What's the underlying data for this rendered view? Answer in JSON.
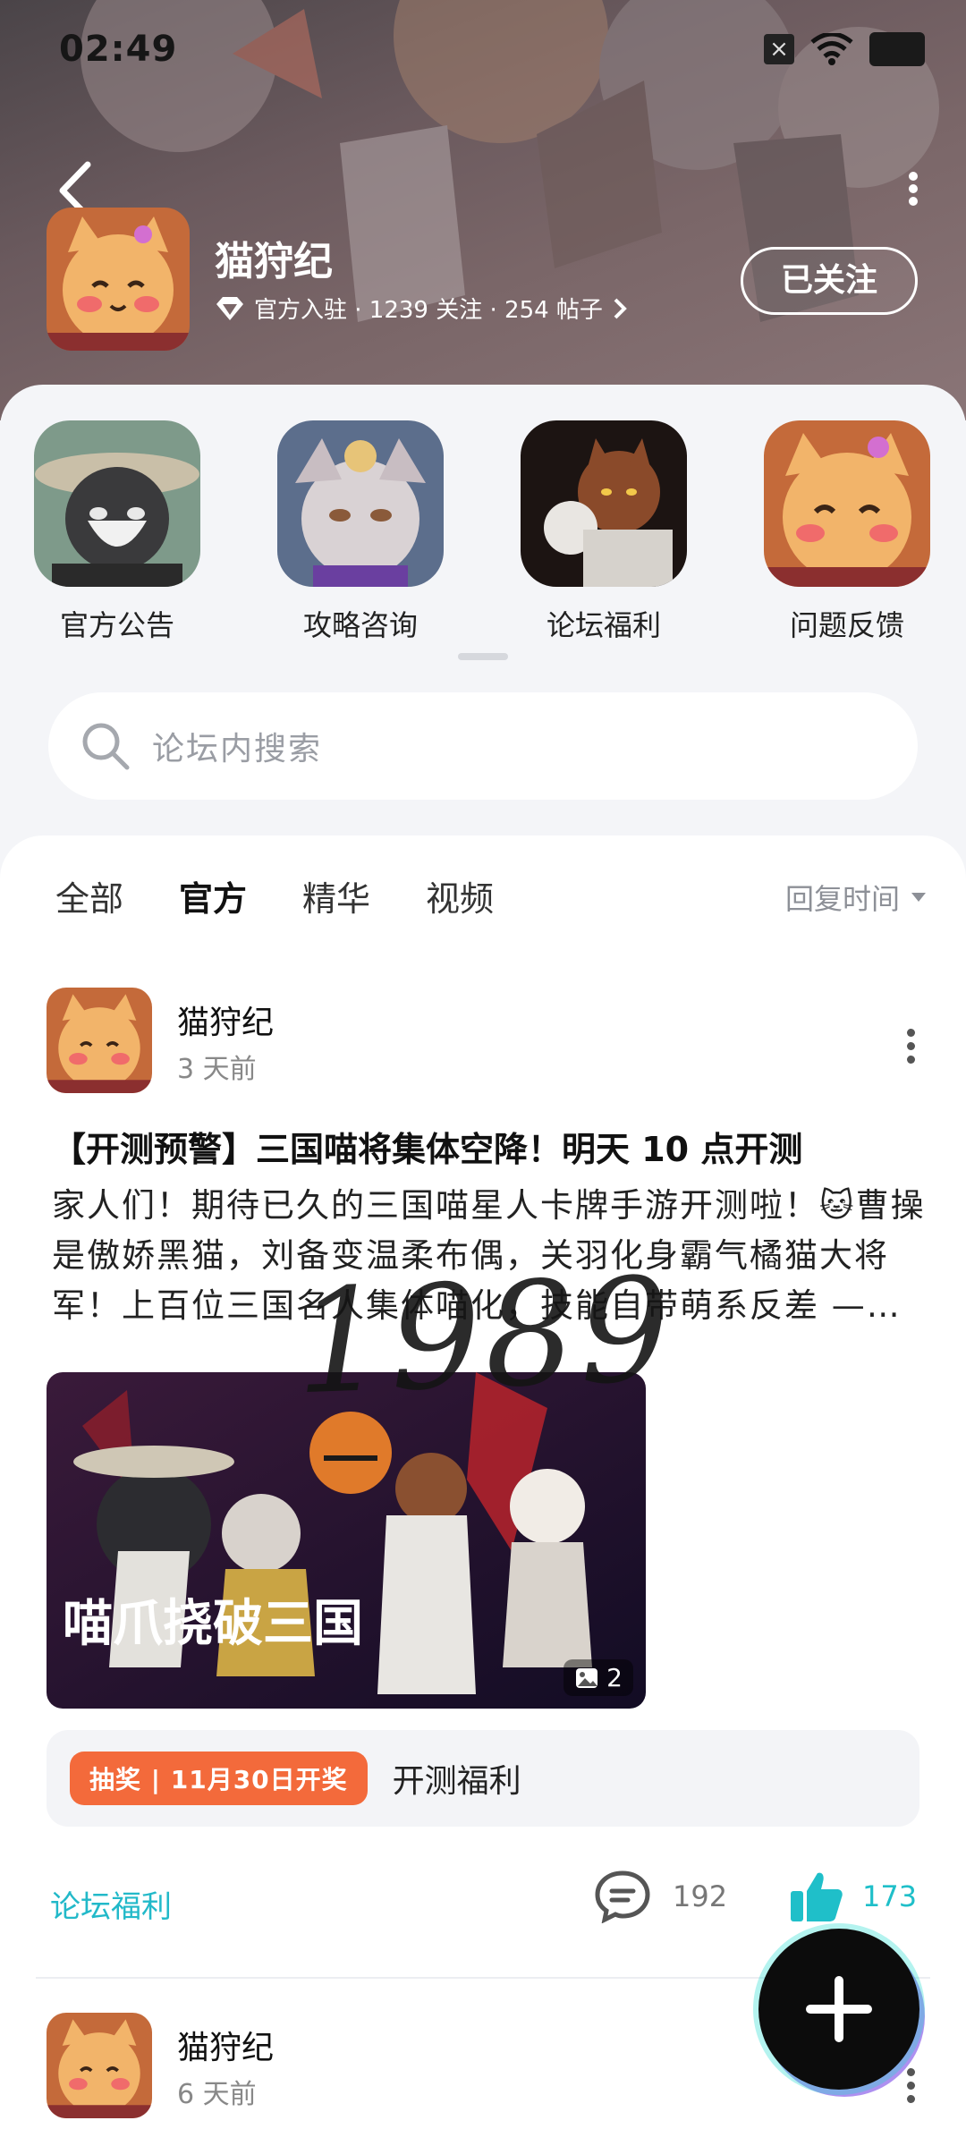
{
  "status_bar": {
    "time": "02:49"
  },
  "forum": {
    "title": "猫狩纪",
    "meta": "官方入驻 · 1239 关注 · 254 帖子",
    "follow_label": "已关注"
  },
  "shortcuts": [
    {
      "label": "官方公告"
    },
    {
      "label": "攻略咨询"
    },
    {
      "label": "论坛福利"
    },
    {
      "label": "问题反馈"
    }
  ],
  "search": {
    "placeholder": "论坛内搜索"
  },
  "tabs": [
    {
      "label": "全部",
      "active": false
    },
    {
      "label": "官方",
      "active": true
    },
    {
      "label": "精华",
      "active": false
    },
    {
      "label": "视频",
      "active": false
    }
  ],
  "sort": {
    "label": "回复时间"
  },
  "posts": [
    {
      "author": "猫狩纪",
      "time": "3 天前",
      "title": "【开测预警】三国喵将集体空降！明天 10 点开测",
      "body": "家人们！期待已久的三国喵星人卡牌手游开测啦！🐱曹操是傲娇黑猫，刘备变温柔布偶，关羽化身霸气橘猫大将军！上百位三国名人集体喵化，技能自带萌系反差 —…",
      "image_count": "2",
      "image_caption": "喵爪挠破三国",
      "lottery_tag": "抽奖 | 11月30日开奖",
      "lottery_text": "开测福利",
      "category": "论坛福利",
      "comments": "192",
      "likes": "173"
    },
    {
      "author": "猫狩纪",
      "time": "6 天前"
    }
  ],
  "watermark": "1989",
  "colors": {
    "accent": "#22b9c9",
    "lottery": "#f36a3b",
    "tab_underline": "#2fd3c5"
  }
}
